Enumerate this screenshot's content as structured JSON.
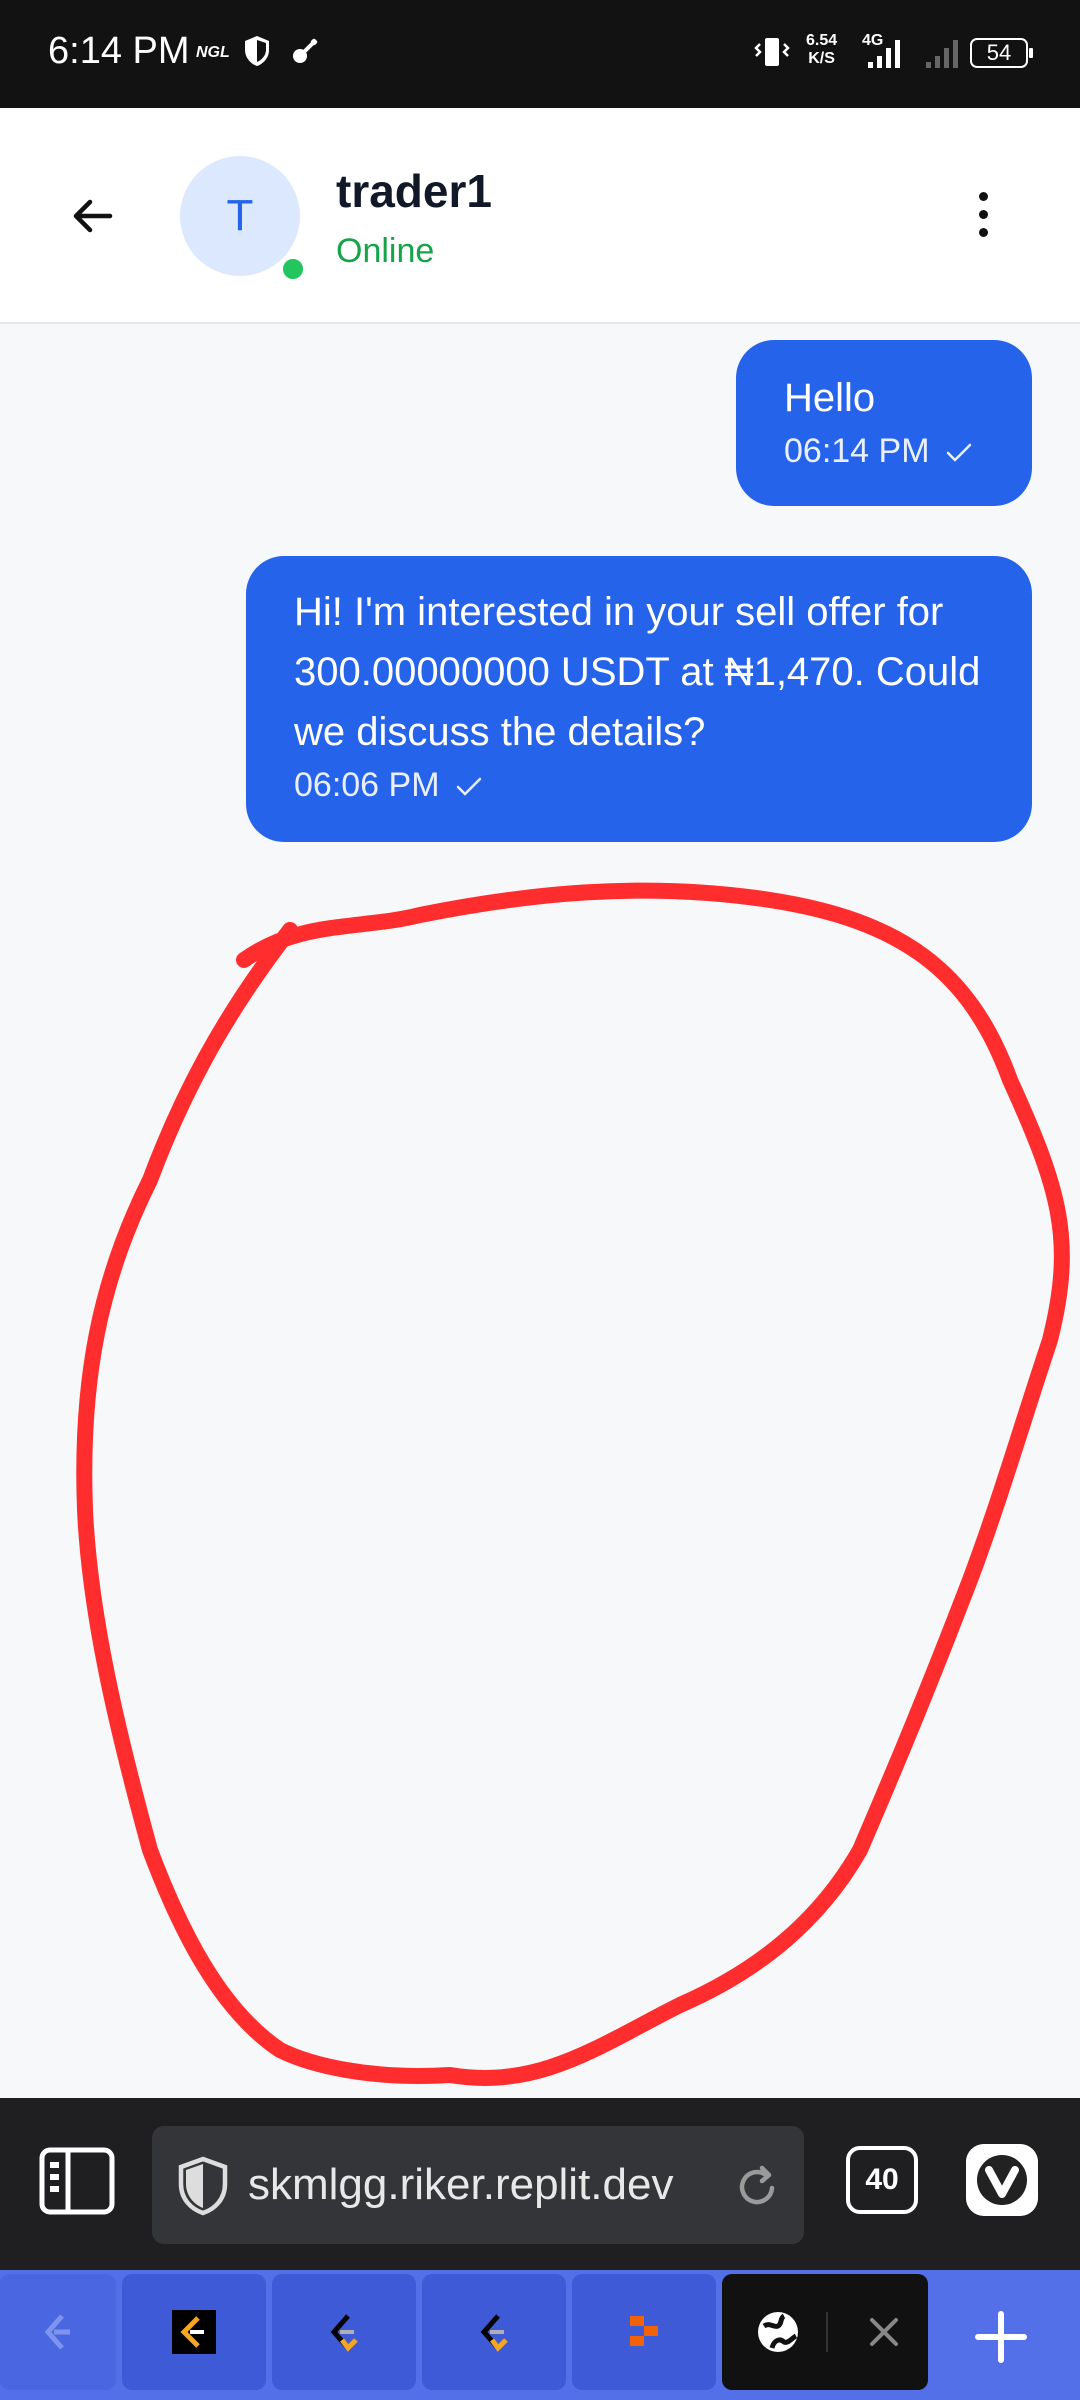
{
  "status_bar": {
    "time": "6:14 PM",
    "carrier_tag": "NGL",
    "net_speed_value": "6.54",
    "net_speed_unit": "K/S",
    "network_type": "4G",
    "battery": "54"
  },
  "header": {
    "avatar_initial": "T",
    "contact_name": "trader1",
    "contact_status": "Online"
  },
  "messages": [
    {
      "text": "Hello",
      "time": "06:14 PM"
    },
    {
      "text": "Hi! I'm interested in your sell offer for 300.00000000 USDT at ₦1,470. Could we discuss the details?",
      "time": "06:06 PM"
    }
  ],
  "browser": {
    "url": "skmlgg.riker.replit.dev",
    "tab_count": "40"
  },
  "colors": {
    "bubble": "#2563eb",
    "online": "#22c55e",
    "annotation": "#ff2d2d",
    "tabstrip": "#5470e8"
  }
}
